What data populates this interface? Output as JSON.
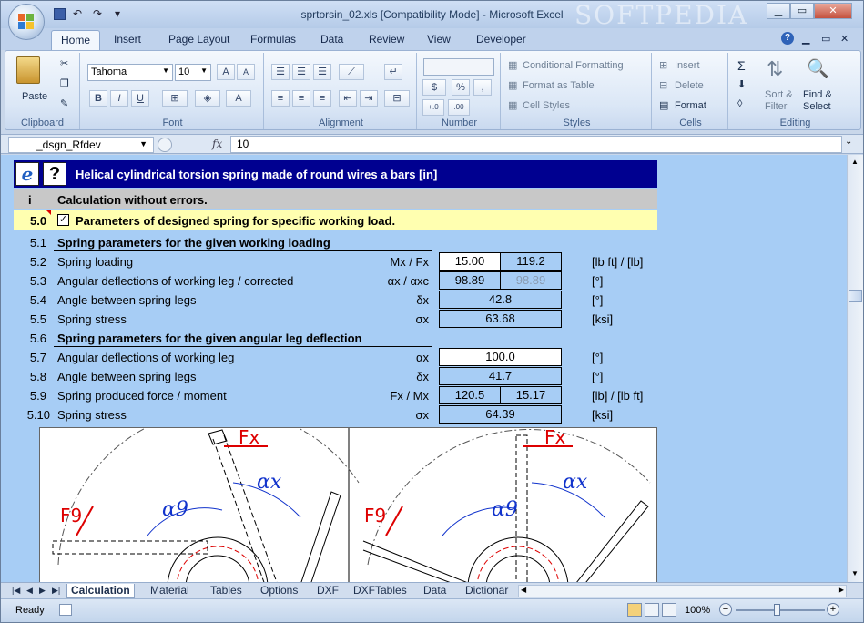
{
  "window": {
    "title": "sprtorsin_02.xls  [Compatibility Mode] - Microsoft Excel",
    "watermark": "SOFTPEDIA",
    "help_icon": "?"
  },
  "ribbon_tabs": [
    "Home",
    "Insert",
    "Page Layout",
    "Formulas",
    "Data",
    "Review",
    "View",
    "Developer"
  ],
  "ribbon": {
    "clipboard": {
      "paste": "Paste",
      "label": "Clipboard"
    },
    "font": {
      "name": "Tahoma",
      "size": "10",
      "label": "Font",
      "bold": "B",
      "italic": "I",
      "underline": "U",
      "grow": "A",
      "shrink": "A",
      "fontcolor": "A"
    },
    "alignment": {
      "label": "Alignment"
    },
    "number": {
      "label": "Number",
      "currency": "$",
      "percent": "%",
      "comma": ",",
      "inc": "+.0",
      "dec": ".00"
    },
    "styles": {
      "cond": "Conditional Formatting",
      "table": "Format as Table",
      "cell": "Cell Styles",
      "label": "Styles"
    },
    "cells": {
      "insert": "Insert",
      "delete": "Delete",
      "format": "Format",
      "label": "Cells"
    },
    "editing": {
      "sum": "Σ",
      "sort": "Sort &",
      "filter": "Filter",
      "find": "Find &",
      "select": "Select",
      "label": "Editing"
    }
  },
  "formula": {
    "name_box": "_dsgn_Rfdev",
    "fx": "fx",
    "value": "10"
  },
  "sheet": {
    "header": "Helical cylindrical torsion spring made of round wires a bars [in]",
    "ie_icon": "e",
    "info_num": "i",
    "info_text": "Calculation without errors.",
    "sec_num": "5.0",
    "check": "✓",
    "sec_text": "Parameters of designed spring for specific working load.",
    "rows": [
      {
        "n": "5.1",
        "label": "Spring parameters for the given working loading"
      },
      {
        "n": "5.2",
        "label": "Spring loading",
        "sym": "Mx / Fx",
        "v1": "15.00",
        "v2": "119.2",
        "unit": "[lb ft] / [lb]"
      },
      {
        "n": "5.3",
        "label": "Angular deflections of working leg / corrected",
        "sym": "αx / αxc",
        "v1": "98.89",
        "v2": "98.89",
        "unit": "[°]"
      },
      {
        "n": "5.4",
        "label": "Angle between spring legs",
        "sym": "δx",
        "v": "42.8",
        "unit": "[°]"
      },
      {
        "n": "5.5",
        "label": "Spring stress",
        "sym": "σx",
        "v": "63.68",
        "unit": "[ksi]"
      },
      {
        "n": "5.6",
        "label": "Spring parameters for the given angular leg deflection"
      },
      {
        "n": "5.7",
        "label": "Angular deflections of working leg",
        "sym": "αx",
        "v": "100.0",
        "unit": "[°]"
      },
      {
        "n": "5.8",
        "label": "Angle between spring legs",
        "sym": "δx",
        "v": "41.7",
        "unit": "[°]"
      },
      {
        "n": "5.9",
        "label": "Spring produced force / moment",
        "sym": "Fx / Mx",
        "v1": "120.5",
        "v2": "15.17",
        "unit": "[lb] / [lb ft]"
      },
      {
        "n": "5.10",
        "label": "Spring stress",
        "sym": "σx",
        "v": "64.39",
        "unit": "[ksi]"
      }
    ],
    "diagram": {
      "fx": "Fx",
      "f9": "F9",
      "ax": "αx",
      "a9": "α9"
    }
  },
  "sheet_tabs": [
    "Calculation",
    "Material",
    "Tables",
    "Options",
    "DXF",
    "DXFTables",
    "Data",
    "Dictionar"
  ],
  "status": {
    "ready": "Ready",
    "zoom": "100%"
  }
}
